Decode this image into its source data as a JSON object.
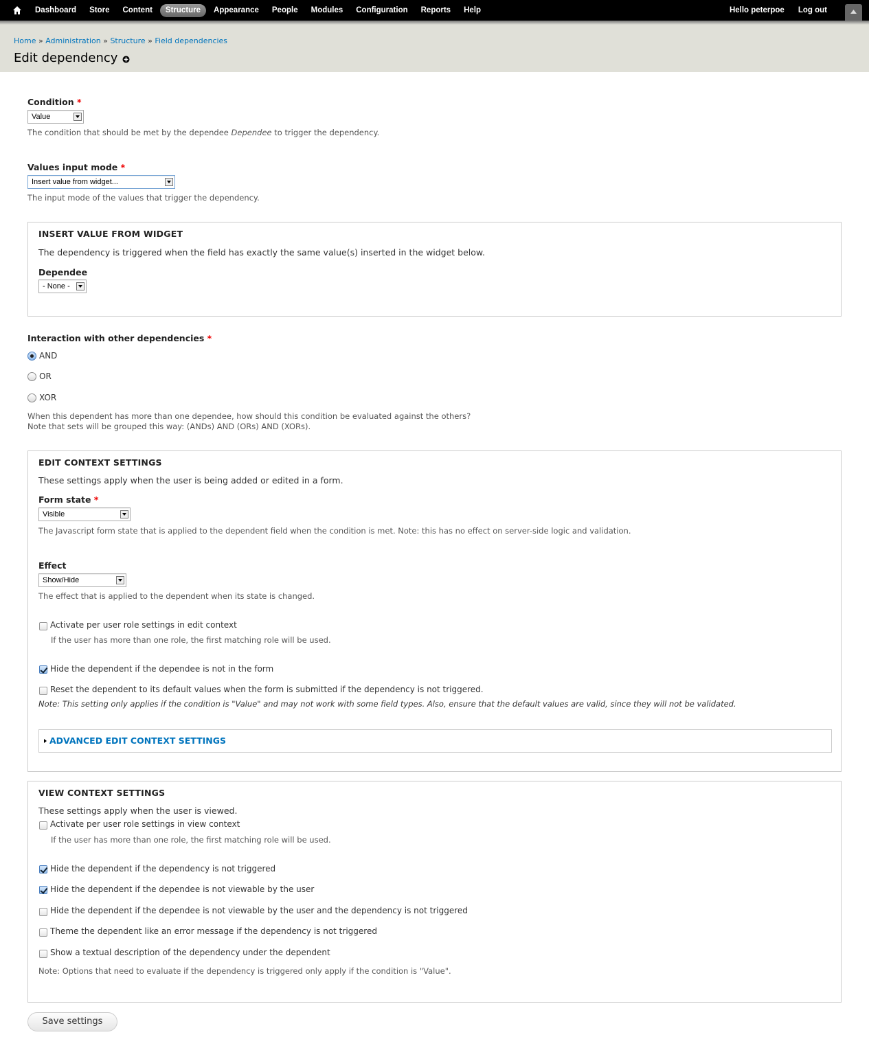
{
  "toolbar": {
    "nav": [
      "Dashboard",
      "Store",
      "Content",
      "Structure",
      "Appearance",
      "People",
      "Modules",
      "Configuration",
      "Reports",
      "Help"
    ],
    "active": "Structure",
    "hello_prefix": "Hello ",
    "username": "peterpoe",
    "logout": "Log out"
  },
  "breadcrumb": [
    "Home",
    "Administration",
    "Structure",
    "Field dependencies"
  ],
  "breadcrumb_sep": " » ",
  "page": {
    "title": "Edit dependency"
  },
  "condition": {
    "label": "Condition",
    "required_mark": "*",
    "value": "Value",
    "desc_before": "The condition that should be met by the dependee ",
    "desc_em": "Dependee",
    "desc_after": " to trigger the dependency."
  },
  "values_input_mode": {
    "label": "Values input mode",
    "required_mark": "*",
    "value": "Insert value from widget...",
    "desc": "The input mode of the values that trigger the dependency."
  },
  "insert_value": {
    "legend": "INSERT VALUE FROM WIDGET",
    "text": "The dependency is triggered when the field has exactly the same value(s) inserted in the widget below.",
    "dependee_label": "Dependee",
    "dependee_value": "- None -"
  },
  "interaction": {
    "label": "Interaction with other dependencies",
    "required_mark": "*",
    "options": [
      "AND",
      "OR",
      "XOR"
    ],
    "selected": "AND",
    "desc_line1": "When this dependent has more than one dependee, how should this condition be evaluated against the others?",
    "desc_line2": "Note that sets will be grouped this way: (ANDs) AND (ORs) AND (XORs)."
  },
  "edit_context": {
    "legend": "EDIT CONTEXT SETTINGS",
    "intro": "These settings apply when the user is being added or edited in a form.",
    "form_state_label": "Form state",
    "required_mark": "*",
    "form_state_value": "Visible",
    "form_state_desc": "The Javascript form state that is applied to the dependent field when the condition is met. Note: this has no effect on server-side logic and validation.",
    "effect_label": "Effect",
    "effect_value": "Show/Hide",
    "effect_desc": "The effect that is applied to the dependent when its state is changed.",
    "per_role_label": "Activate per user role settings in edit context",
    "per_role_checked": false,
    "per_role_desc": "If the user has more than one role, the first matching role will be used.",
    "hide_not_in_form_label": "Hide the dependent if the dependee is not in the form",
    "hide_not_in_form_checked": true,
    "reset_label": "Reset the dependent to its default values when the form is submitted if the dependency is not triggered.",
    "reset_checked": false,
    "reset_note": "Note: This setting only applies if the condition is \"Value\" and may not work with some field types. Also, ensure that the default values are valid, since they will not be validated.",
    "advanced_label": "ADVANCED EDIT CONTEXT SETTINGS"
  },
  "view_context": {
    "legend": "VIEW CONTEXT SETTINGS",
    "intro": "These settings apply when the user is viewed.",
    "per_role_label": "Activate per user role settings in view context",
    "per_role_checked": false,
    "per_role_desc": "If the user has more than one role, the first matching role will be used.",
    "options": [
      {
        "label": "Hide the dependent if the dependency is not triggered",
        "checked": true
      },
      {
        "label": "Hide the dependent if the dependee is not viewable by the user",
        "checked": true
      },
      {
        "label": "Hide the dependent if the dependee is not viewable by the user and the dependency is not triggered",
        "checked": false
      },
      {
        "label": "Theme the dependent like an error message if the dependency is not triggered",
        "checked": false
      },
      {
        "label": "Show a textual description of the dependency under the dependent",
        "checked": false
      }
    ],
    "note": "Note: Options that need to evaluate if the dependency is triggered only apply if the condition is \"Value\"."
  },
  "actions": {
    "save_label": "Save settings"
  }
}
